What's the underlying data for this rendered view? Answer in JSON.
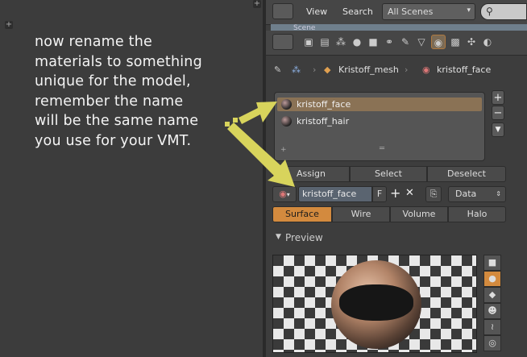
{
  "tutorial": {
    "text": "now rename the\nmaterials to something\nunique for the model,\nremember the name\nwill be the same name\nyou use for your VMT."
  },
  "header": {
    "menus": [
      "View",
      "Search"
    ],
    "scene_selector": "All Scenes",
    "outliner_row": "Scene"
  },
  "breadcrumb": {
    "object": "Kristoff_mesh",
    "material": "kristoff_face"
  },
  "material_slots": {
    "items": [
      "kristoff_face",
      "kristoff_hair"
    ],
    "selected_index": 0
  },
  "slot_buttons": {
    "add": "+",
    "remove": "−",
    "menu": "▼"
  },
  "assign_row": {
    "assign": "Assign",
    "select": "Select",
    "deselect": "Deselect"
  },
  "material_row": {
    "name": "kristoff_face",
    "fake_user": "F",
    "new": "+",
    "unlink": "✕",
    "link": "Data"
  },
  "type_tabs": {
    "items": [
      "Surface",
      "Wire",
      "Volume",
      "Halo"
    ],
    "active": "Surface"
  },
  "preview": {
    "label": "Preview",
    "active_shape": "sphere"
  },
  "colors": {
    "accent": "#d38a3e",
    "annotation": "#d8d45c",
    "selected_slot": "#8a7255"
  }
}
